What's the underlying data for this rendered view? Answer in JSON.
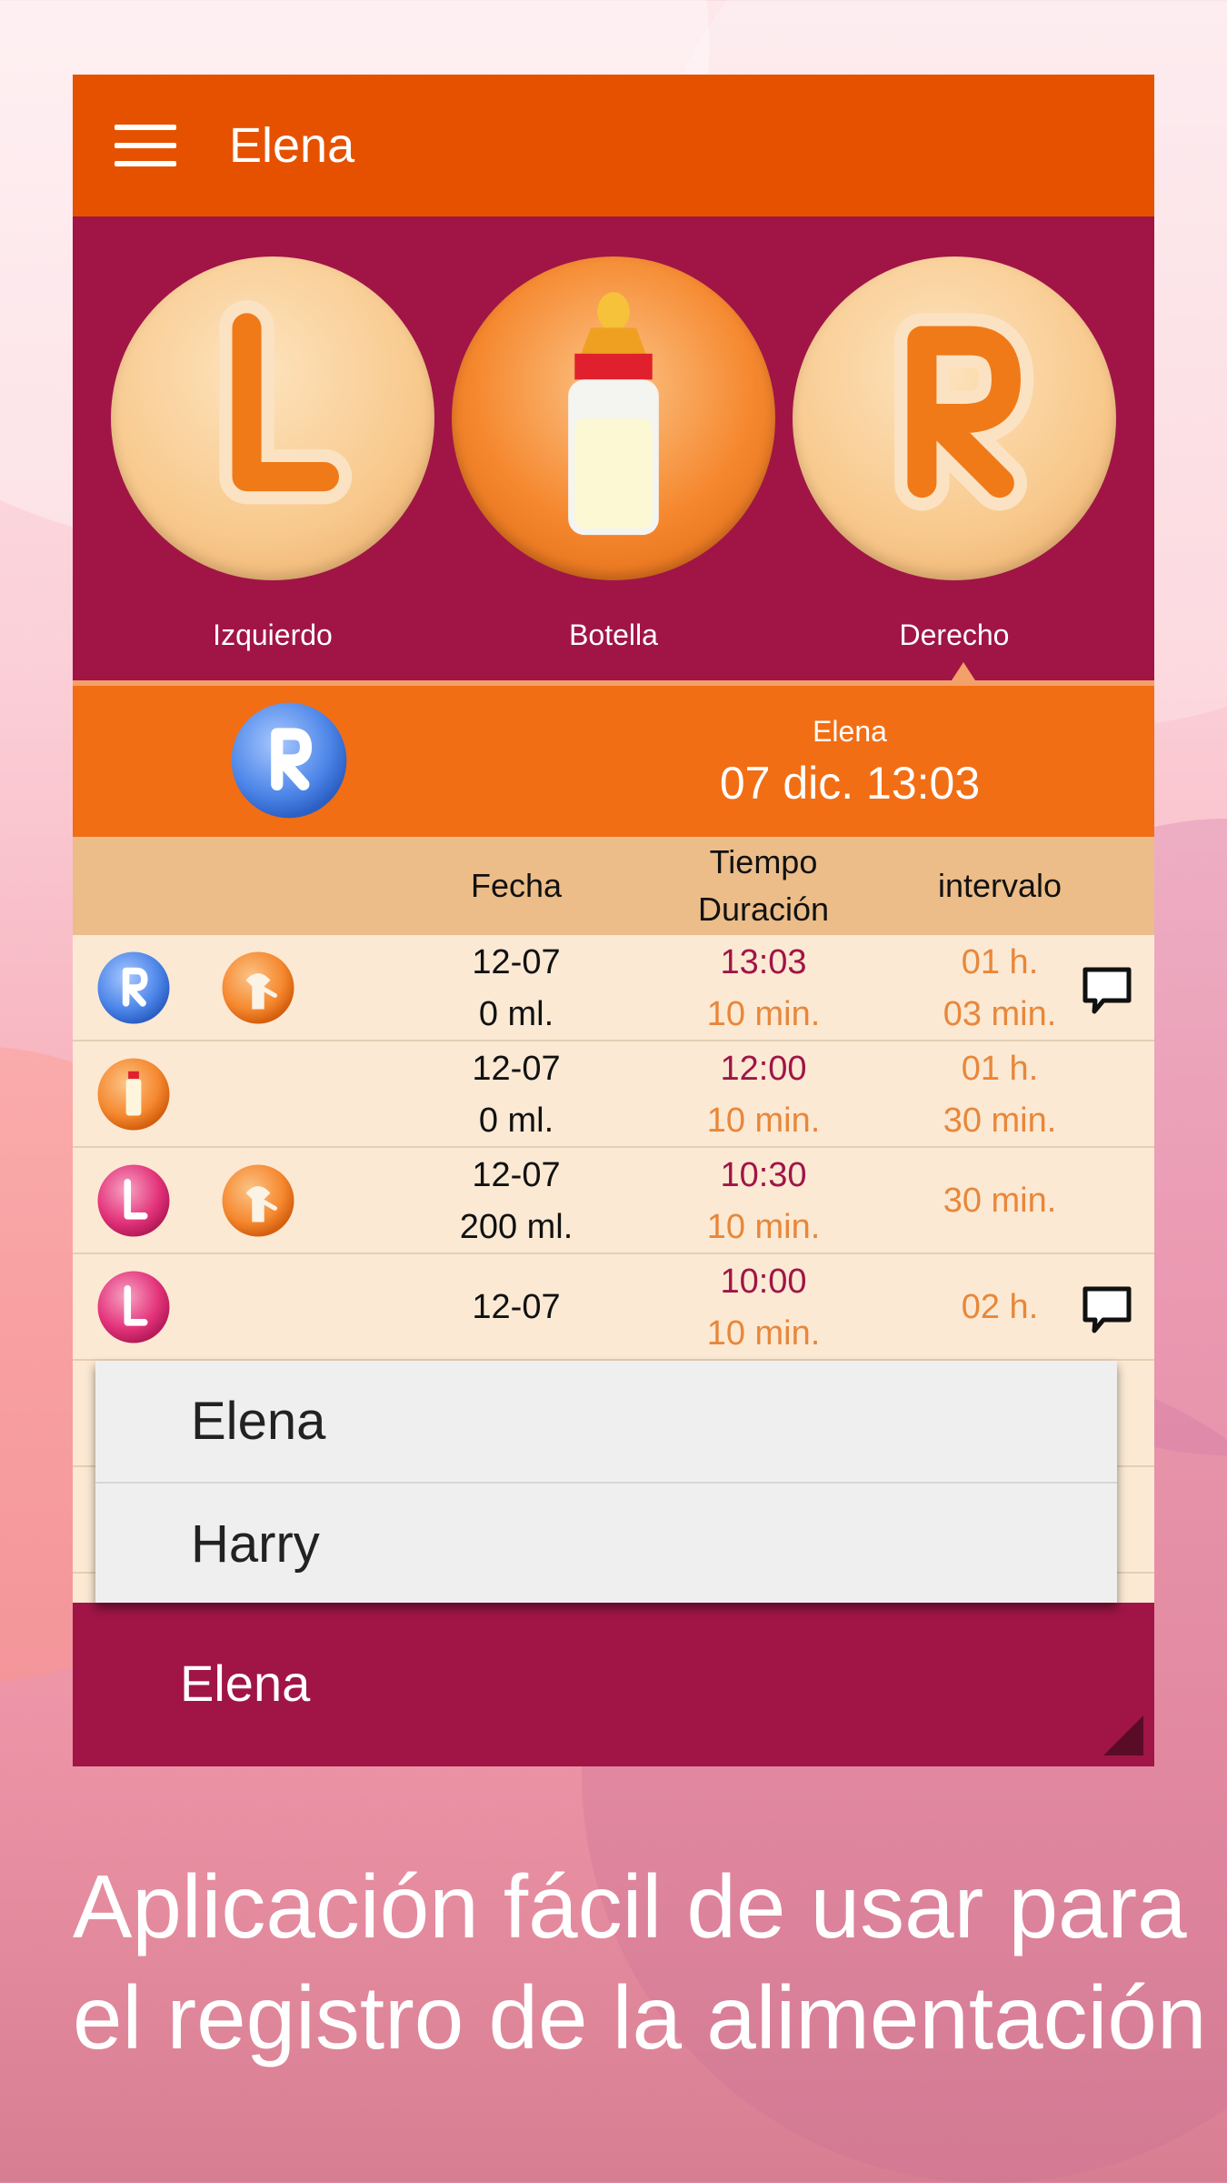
{
  "app": {
    "title": "Elena",
    "menu_icon": "hamburger-menu-icon"
  },
  "feed_picker": {
    "left": {
      "label": "Izquierdo",
      "icon": "left-breast-L-icon"
    },
    "bottle": {
      "label": "Botella",
      "icon": "baby-bottle-icon"
    },
    "right": {
      "label": "Derecho",
      "icon": "right-breast-R-icon"
    },
    "selected": "right"
  },
  "current": {
    "name": "Elena",
    "datetime": "07 dic. 13:03",
    "icon": "right-breast-R-icon"
  },
  "table": {
    "headers": {
      "fecha": "Fecha",
      "tiempo": "Tiempo",
      "duracion": "Duración",
      "intervalo": "intervalo"
    },
    "rows": [
      {
        "type": "R",
        "pump": true,
        "date": "12-07",
        "amount": "0 ml.",
        "time": "13:03",
        "duration": "10 min.",
        "interval1": "01 h.",
        "interval2": "03 min.",
        "comment": true
      },
      {
        "type": "B",
        "pump": false,
        "date": "12-07",
        "amount": "0 ml.",
        "time": "12:00",
        "duration": "10 min.",
        "interval1": "01 h.",
        "interval2": "30 min.",
        "comment": false
      },
      {
        "type": "L",
        "pump": true,
        "date": "12-07",
        "amount": "200 ml.",
        "time": "10:30",
        "duration": "10 min.",
        "interval1": "30 min.",
        "interval2": "",
        "comment": false
      },
      {
        "type": "L",
        "pump": false,
        "date": "12-07",
        "amount": "",
        "time": "10:00",
        "duration": "10 min.",
        "interval1": "02 h.",
        "interval2": "",
        "comment": true
      }
    ]
  },
  "dropdown": {
    "options": [
      "Elena",
      "Harry"
    ]
  },
  "bottom": {
    "selected_name": "Elena"
  },
  "caption": {
    "line1": "Aplicación fácil de usar para",
    "line2": "el registro de la alimentación"
  },
  "colors": {
    "appbar": "#e65100",
    "picker_bg": "#a01546",
    "status_bg": "#f26e14",
    "header_bg": "#ecbd88",
    "row_bg": "#fbe9d4"
  }
}
